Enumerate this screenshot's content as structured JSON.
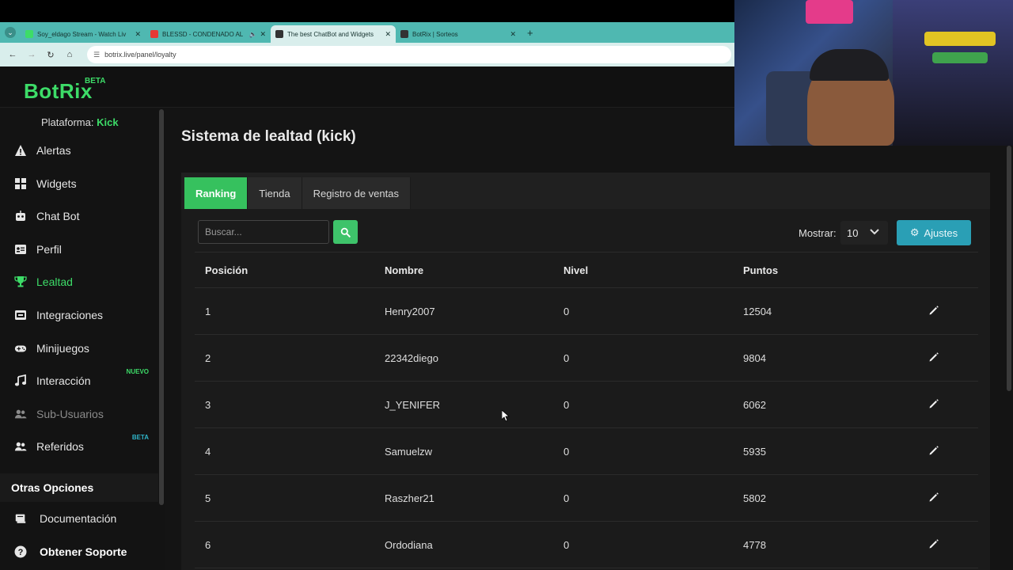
{
  "browser": {
    "tabs": [
      {
        "title": "Soy_eldago Stream - Watch Liv",
        "favicon_color": "#3ddc68",
        "active": false,
        "audio": false
      },
      {
        "title": "BLESSD - CONDENADO AL",
        "favicon_color": "#e53935",
        "active": false,
        "audio": true
      },
      {
        "title": "The best ChatBot and Widgets",
        "favicon_color": "#333333",
        "active": true,
        "audio": false
      },
      {
        "title": "BotRix | Sorteos",
        "favicon_color": "#333333",
        "active": false,
        "audio": false
      }
    ],
    "new_tab_label": "+",
    "url": "botrix.live/panel/loyalty"
  },
  "app": {
    "logo": "BotRix",
    "logo_badge": "BETA",
    "accent_color": "#3ddc68"
  },
  "sidebar": {
    "platform_label": "Plataforma:",
    "platform_value": "Kick",
    "items": [
      {
        "label": "Alertas",
        "icon": "warning-icon",
        "state": "normal",
        "badge": ""
      },
      {
        "label": "Widgets",
        "icon": "grid-icon",
        "state": "normal",
        "badge": ""
      },
      {
        "label": "Chat Bot",
        "icon": "robot-icon",
        "state": "normal",
        "badge": ""
      },
      {
        "label": "Perfil",
        "icon": "id-card-icon",
        "state": "normal",
        "badge": ""
      },
      {
        "label": "Lealtad",
        "icon": "trophy-icon",
        "state": "active",
        "badge": ""
      },
      {
        "label": "Integraciones",
        "icon": "integration-icon",
        "state": "normal",
        "badge": ""
      },
      {
        "label": "Minijuegos",
        "icon": "gamepad-icon",
        "state": "normal",
        "badge": ""
      },
      {
        "label": "Interacción",
        "icon": "music-icon",
        "state": "normal",
        "badge": "NUEVO"
      },
      {
        "label": "Sub-Usuarios",
        "icon": "users-icon",
        "state": "disabled",
        "badge": ""
      },
      {
        "label": "Referidos",
        "icon": "users-icon",
        "state": "normal",
        "badge": "BETA"
      }
    ],
    "section_title": "Otras Opciones",
    "other_items": [
      {
        "label": "Documentación",
        "icon": "book-icon"
      },
      {
        "label": "Obtener Soporte",
        "icon": "question-icon"
      }
    ]
  },
  "main": {
    "title": "Sistema de lealtad (kick)",
    "tabs": [
      {
        "label": "Ranking",
        "active": true
      },
      {
        "label": "Tienda",
        "active": false
      },
      {
        "label": "Registro de ventas",
        "active": false
      }
    ],
    "search_placeholder": "Buscar...",
    "show_label": "Mostrar:",
    "show_value": "10",
    "settings_label": "Ajustes",
    "table": {
      "headers": [
        "Posición",
        "Nombre",
        "Nivel",
        "Puntos"
      ],
      "rows": [
        {
          "pos": "1",
          "name": "Henry2007",
          "level": "0",
          "points": "12504"
        },
        {
          "pos": "2",
          "name": "22342diego",
          "level": "0",
          "points": "9804"
        },
        {
          "pos": "3",
          "name": "J_YENIFER",
          "level": "0",
          "points": "6062"
        },
        {
          "pos": "4",
          "name": "Samuelzw",
          "level": "0",
          "points": "5935"
        },
        {
          "pos": "5",
          "name": "Raszher21",
          "level": "0",
          "points": "5802"
        },
        {
          "pos": "6",
          "name": "Ordodiana",
          "level": "0",
          "points": "4778"
        }
      ]
    }
  }
}
